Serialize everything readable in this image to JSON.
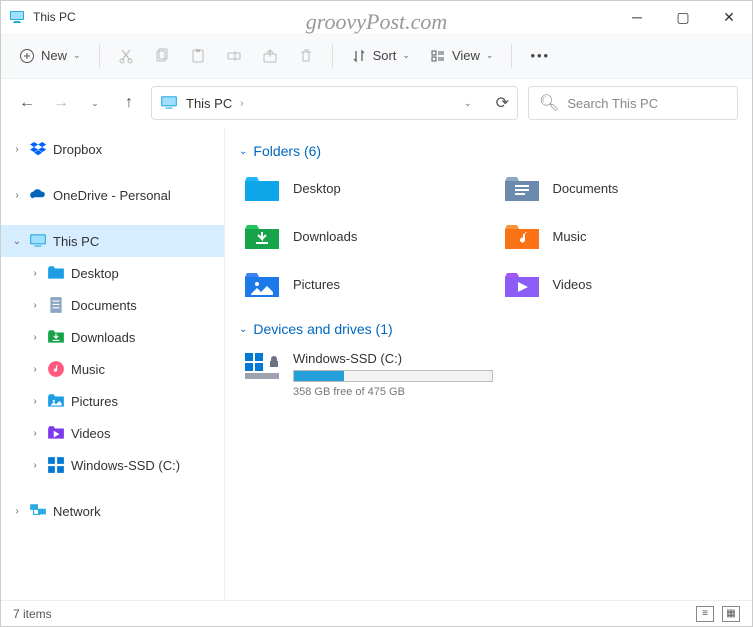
{
  "window": {
    "title": "This PC",
    "watermark": "groovyPost.com"
  },
  "toolbar": {
    "new": "New",
    "sort": "Sort",
    "view": "View"
  },
  "breadcrumb": {
    "root": "This PC"
  },
  "search": {
    "placeholder": "Search This PC"
  },
  "sidebar": {
    "dropbox": "Dropbox",
    "onedrive": "OneDrive - Personal",
    "thispc": "This PC",
    "desktop": "Desktop",
    "documents": "Documents",
    "downloads": "Downloads",
    "music": "Music",
    "pictures": "Pictures",
    "videos": "Videos",
    "ssd": "Windows-SSD (C:)",
    "network": "Network"
  },
  "sections": {
    "folders_label": "Folders (6)",
    "drives_label": "Devices and drives (1)"
  },
  "folders": {
    "desktop": "Desktop",
    "documents": "Documents",
    "downloads": "Downloads",
    "music": "Music",
    "pictures": "Pictures",
    "videos": "Videos"
  },
  "drive": {
    "name": "Windows-SSD (C:)",
    "free_text": "358 GB free of 475 GB",
    "used_pct": 25
  },
  "status": {
    "items": "7 items"
  }
}
